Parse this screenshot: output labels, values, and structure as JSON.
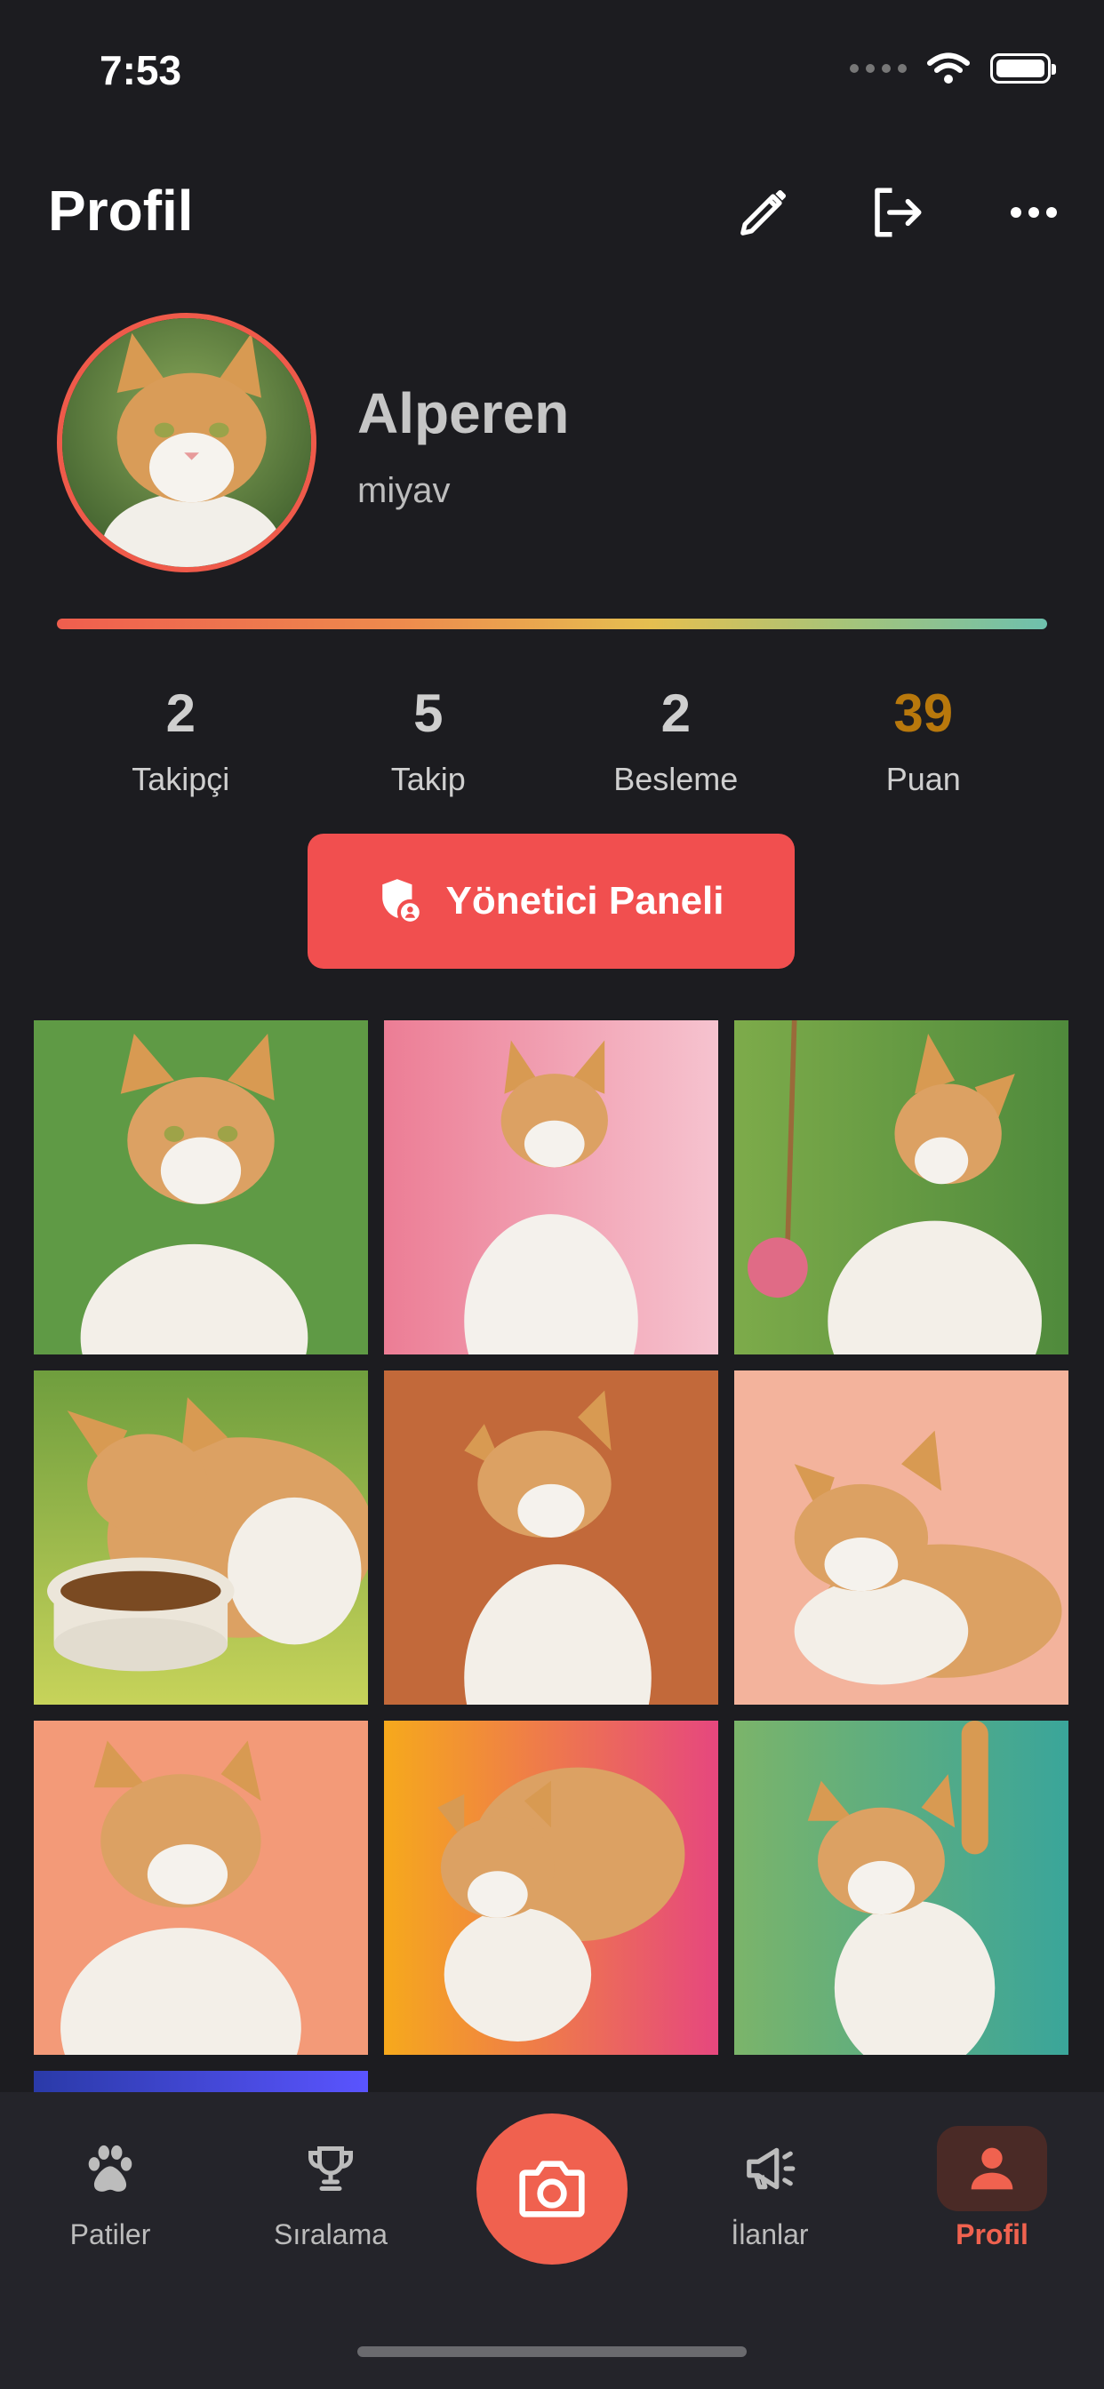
{
  "status_bar": {
    "time": "7:53"
  },
  "header": {
    "title": "Profil"
  },
  "profile": {
    "name": "Alperen",
    "bio": "miyav"
  },
  "stats": [
    {
      "value": "2",
      "label": "Takipçi"
    },
    {
      "value": "5",
      "label": "Takip"
    },
    {
      "value": "2",
      "label": "Besleme"
    },
    {
      "value": "39",
      "label": "Puan"
    }
  ],
  "admin_button": {
    "label": "Yönetici Paneli"
  },
  "colors": {
    "accent": "#f0614f",
    "admin_button": "#f14f4f",
    "points": "#b8780c",
    "background": "#1c1c20"
  },
  "tabs": [
    {
      "label": "Patiler",
      "icon": "paw-icon"
    },
    {
      "label": "Sıralama",
      "icon": "trophy-icon"
    },
    {
      "label": "",
      "icon": "camera-icon"
    },
    {
      "label": "İlanlar",
      "icon": "megaphone-icon"
    },
    {
      "label": "Profil",
      "icon": "person-icon",
      "active": true
    }
  ]
}
